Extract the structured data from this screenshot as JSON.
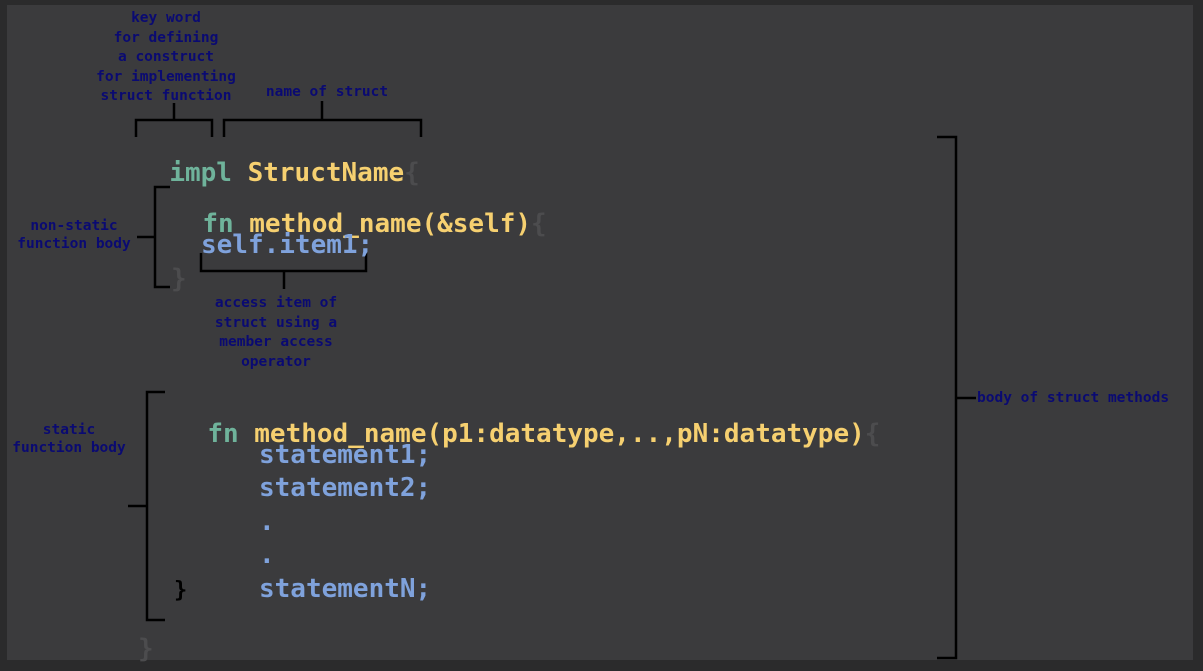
{
  "colors": {
    "background": "#3b3b3d",
    "keyword": "#6fb39b",
    "name": "#f6d070",
    "body_code": "#7fa2dc",
    "brace": "#4c4c4e",
    "annotation": "#0a0a72",
    "bracket": "#000000"
  },
  "code": {
    "impl_keyword": "impl",
    "struct_name": "StructName",
    "open_brace": "{",
    "close_brace": "}",
    "method1": {
      "keyword": "fn",
      "signature": "method_name(&self)",
      "open_brace": "{",
      "statement": "self.item1;",
      "close_brace": "}"
    },
    "method2": {
      "keyword": "fn",
      "signature": "method_name(p1:datatype,..,pN:datatype)",
      "open_brace": "{",
      "statements": [
        "statement1;",
        "statement2;",
        ".",
        ".",
        "statementN;"
      ],
      "close_brace": "}"
    }
  },
  "annotations": {
    "keyword": "key word\nfor defining\na construct\nfor implementing\nstruct function",
    "struct_name": "name of struct",
    "non_static": "non-static\nfunction body",
    "access_item": "access item of\nstruct using a\nmember access\noperator",
    "static": "static\nfunction body",
    "body": "body of struct methods"
  }
}
